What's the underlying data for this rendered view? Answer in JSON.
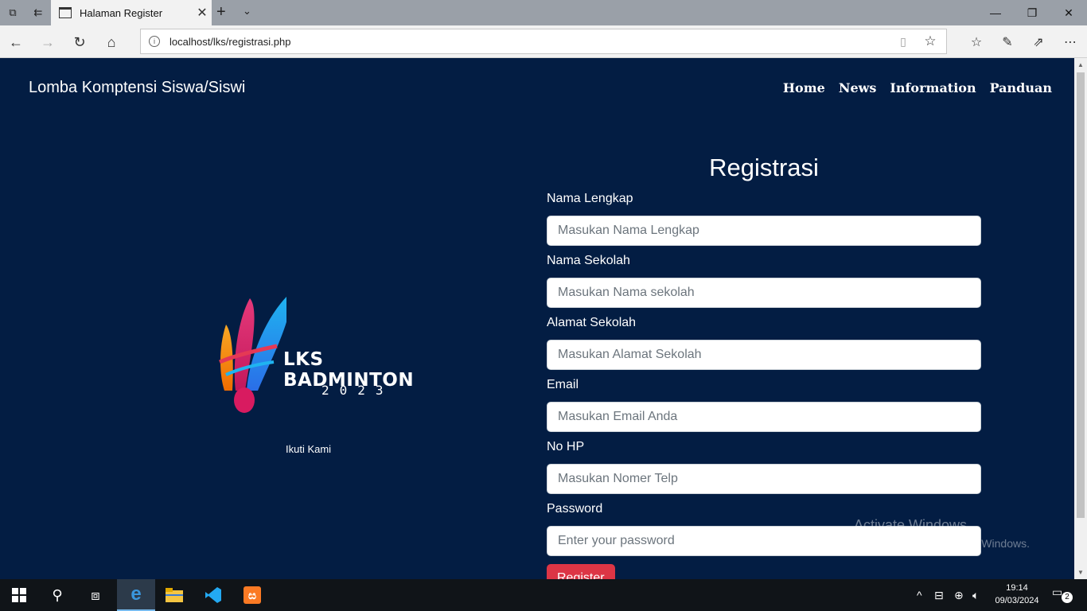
{
  "browser": {
    "tab_title": "Halaman Register",
    "url": "localhost/lks/registrasi.php"
  },
  "site": {
    "brand": "Lomba Komptensi Siswa/Siswi",
    "nav": [
      "Home",
      "News",
      "Information",
      "Panduan"
    ]
  },
  "logo": {
    "title": "LKS BADMINTON",
    "year": "2023"
  },
  "social_label": "Ikuti Kami",
  "form": {
    "title": "Registrasi",
    "fields": [
      {
        "label": "Nama Lengkap",
        "placeholder": "Masukan Nama Lengkap"
      },
      {
        "label": "Nama Sekolah",
        "placeholder": "Masukan Nama sekolah"
      },
      {
        "label": "Alamat Sekolah",
        "placeholder": "Masukan Alamat Sekolah"
      },
      {
        "label": "Email",
        "placeholder": "Masukan Email Anda"
      },
      {
        "label": "No HP",
        "placeholder": "Masukan Nomer Telp"
      },
      {
        "label": "Password",
        "placeholder": "Enter your password"
      }
    ],
    "submit_label": "Register"
  },
  "watermark": {
    "line1": "Activate Windows",
    "line2": "Go to Settings to activate Windows."
  },
  "taskbar": {
    "time": "19:14",
    "date": "09/03/2024",
    "notification_count": "2"
  },
  "colors": {
    "page_bg": "#031d43",
    "button_red": "#dc3545"
  }
}
